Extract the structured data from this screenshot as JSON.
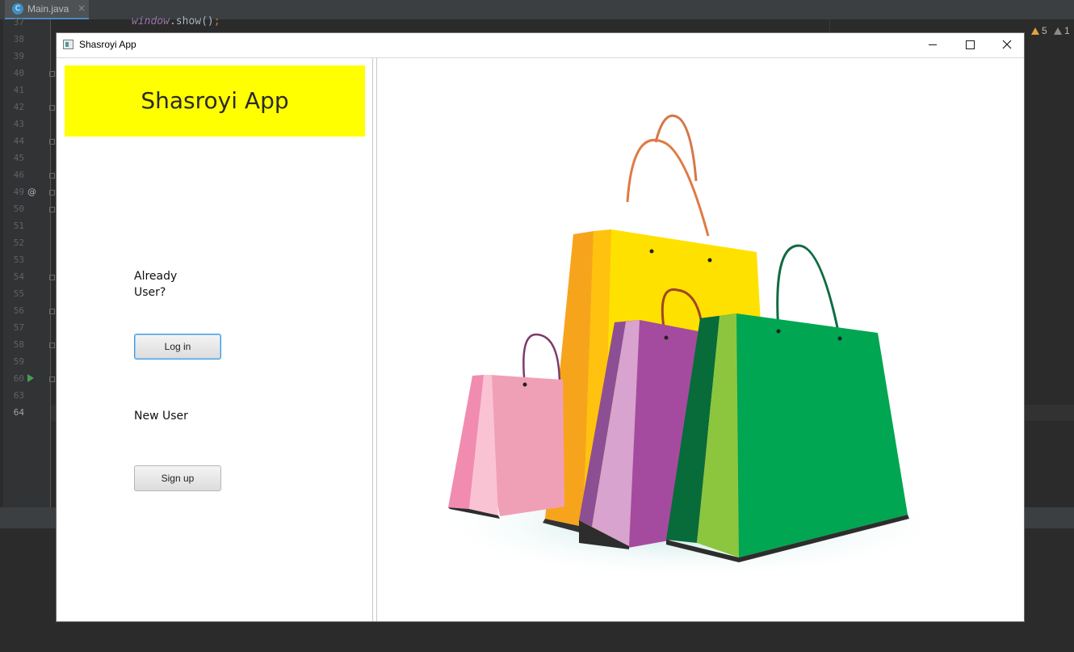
{
  "ide": {
    "tab_label": "Main.java",
    "tab_close": "×",
    "line_numbers": [
      "37",
      "38",
      "39",
      "40",
      "41",
      "42",
      "43",
      "44",
      "45",
      "46",
      "49",
      "50",
      "51",
      "52",
      "53",
      "54",
      "55",
      "56",
      "57",
      "58",
      "59",
      "60",
      "63",
      "64"
    ],
    "code_snippet": {
      "object": "window",
      "method": ".show()",
      "semicolon": ";"
    },
    "at_marker": "@",
    "warnings_count": "5",
    "weak_warnings_count": "1"
  },
  "window": {
    "title": "Shasroyi App"
  },
  "app": {
    "header_title": "Shasroyi App",
    "header_color": "#ffff00",
    "existing_prompt": "Already User?",
    "login_button": "Log in",
    "new_prompt": "New User",
    "signup_button": "Sign up",
    "image_description_icon": "shopping-bags-image"
  }
}
